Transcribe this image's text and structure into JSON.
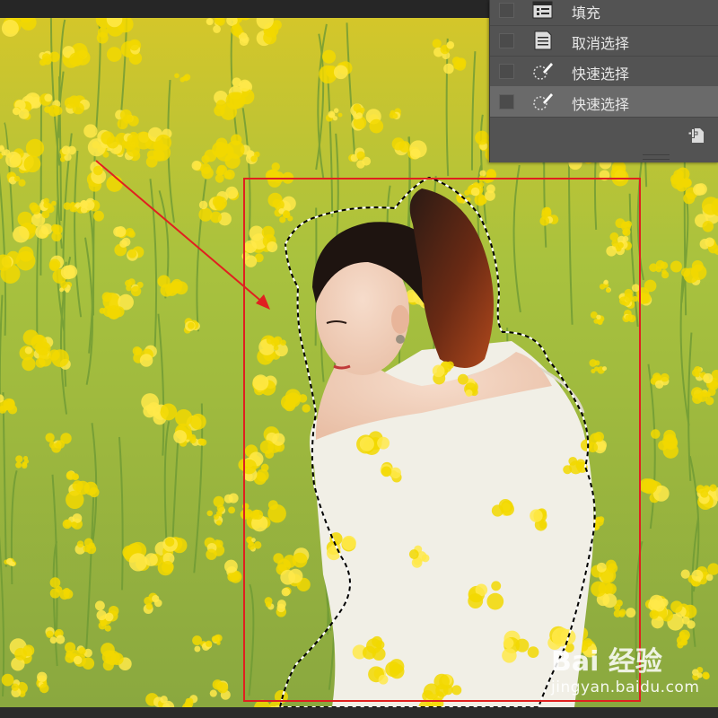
{
  "history_panel": {
    "items": [
      {
        "label": "填充",
        "icon": "fill-icon",
        "active": false
      },
      {
        "label": "取消选择",
        "icon": "document-icon",
        "active": false
      },
      {
        "label": "快速选择",
        "icon": "quick-selection-icon",
        "active": false
      },
      {
        "label": "快速选择",
        "icon": "quick-selection-icon",
        "active": true
      }
    ],
    "footer_icon": "new-document-from-state-icon"
  },
  "annotations": {
    "rect_color": "#e02020",
    "arrow_color": "#e02020"
  },
  "watermark": {
    "logo_text": "Bai 经验",
    "url": "jingyan.baidu.com"
  },
  "colors": {
    "field_green": "#8db84a",
    "flower_yellow": "#f2d800",
    "panel_bg": "#535353",
    "panel_active": "#6a6a6a"
  }
}
